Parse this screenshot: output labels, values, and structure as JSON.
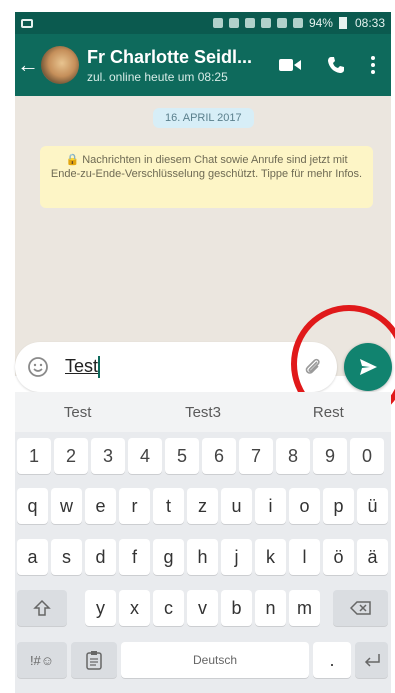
{
  "status_bar": {
    "battery": "94%",
    "time": "08:33"
  },
  "header": {
    "title": "Fr Charlotte Seidl...",
    "subtitle": "zul. online heute um 08:25"
  },
  "chat": {
    "date_label": "16. APRIL 2017",
    "encryption_notice": "🔒 Nachrichten in diesem Chat sowie Anrufe sind jetzt mit Ende-zu-Ende-Verschlüsselung geschützt. Tippe für mehr Infos."
  },
  "compose": {
    "text": "Test"
  },
  "suggestions": [
    "Test",
    "Test3",
    "Rest"
  ],
  "keyboard": {
    "row_numbers": [
      "1",
      "2",
      "3",
      "4",
      "5",
      "6",
      "7",
      "8",
      "9",
      "0"
    ],
    "row1": [
      "q",
      "w",
      "e",
      "r",
      "t",
      "z",
      "u",
      "i",
      "o",
      "p",
      "ü"
    ],
    "row2": [
      "a",
      "s",
      "d",
      "f",
      "g",
      "h",
      "j",
      "k",
      "l",
      "ö",
      "ä"
    ],
    "row3": [
      "y",
      "x",
      "c",
      "v",
      "b",
      "n",
      "m"
    ],
    "sym_key": "!#☺",
    "space_label": "Deutsch",
    "period_key": "."
  },
  "colors": {
    "header": "#0e6a5c",
    "status_bar": "#0b5a4f",
    "send_button": "#11836f",
    "highlight": "#e0191a",
    "chat_background": "#ebe6df",
    "notice_background": "#fdf5c6"
  },
  "icons": [
    "message-icon",
    "back-arrow-icon",
    "video-call-icon",
    "phone-icon",
    "menu-icon",
    "emoji-icon",
    "attach-icon",
    "send-icon",
    "shift-icon",
    "backspace-icon",
    "clipboard-icon",
    "enter-icon"
  ]
}
